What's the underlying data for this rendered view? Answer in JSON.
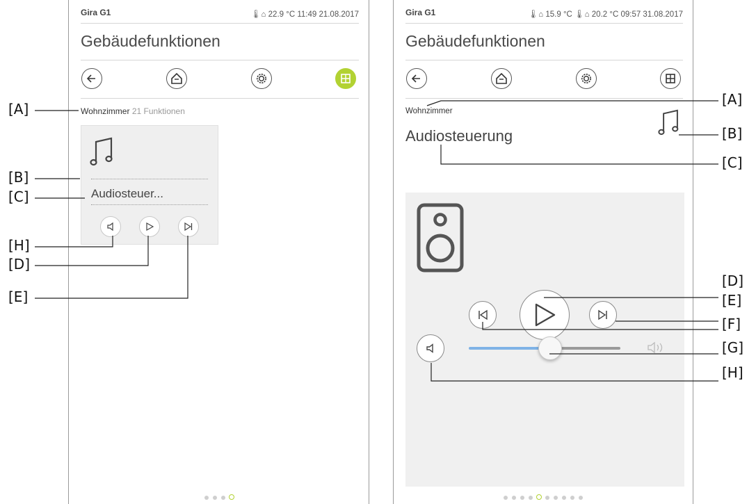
{
  "left_screen": {
    "brand": "Gira G1",
    "status_info": "🌡⌂ 22.9 °C  11:49  21.08.2017",
    "title": "Gebäudefunktionen",
    "room": "Wohnzimmer",
    "count": "21",
    "count_label": "Funktionen",
    "tile_name": "Audiosteuer...",
    "page_dots": 4,
    "active_dot": 4
  },
  "right_screen": {
    "brand": "Gira G1",
    "status_info": "🌡⌂ 15.9 °C  🌡⌂ 20.2 °C  09:57  31.08.2017",
    "title": "Gebäudefunktionen",
    "room": "Wohnzimmer",
    "function_title": "Audiosteuerung",
    "volume_level": 0.5,
    "page_dots": 10,
    "active_dot": 5
  },
  "callouts_left": [
    "[A]",
    "[B]",
    "[C]",
    "[H]",
    "[D]",
    "[E]"
  ],
  "callouts_right": [
    "[A]",
    "[B]",
    "[C]",
    "[D]",
    "[E]",
    "[F]",
    "[G]",
    "[H]"
  ],
  "colors": {
    "accent": "#b2d233",
    "slider_fill": "#7fb3e6"
  },
  "icons": [
    "back-arrow-icon",
    "home-icon",
    "gear-icon",
    "grid-icon",
    "music-note-icon",
    "speaker-icon",
    "mute-icon",
    "play-icon",
    "skip-forward-icon",
    "skip-back-icon",
    "volume-icon"
  ]
}
